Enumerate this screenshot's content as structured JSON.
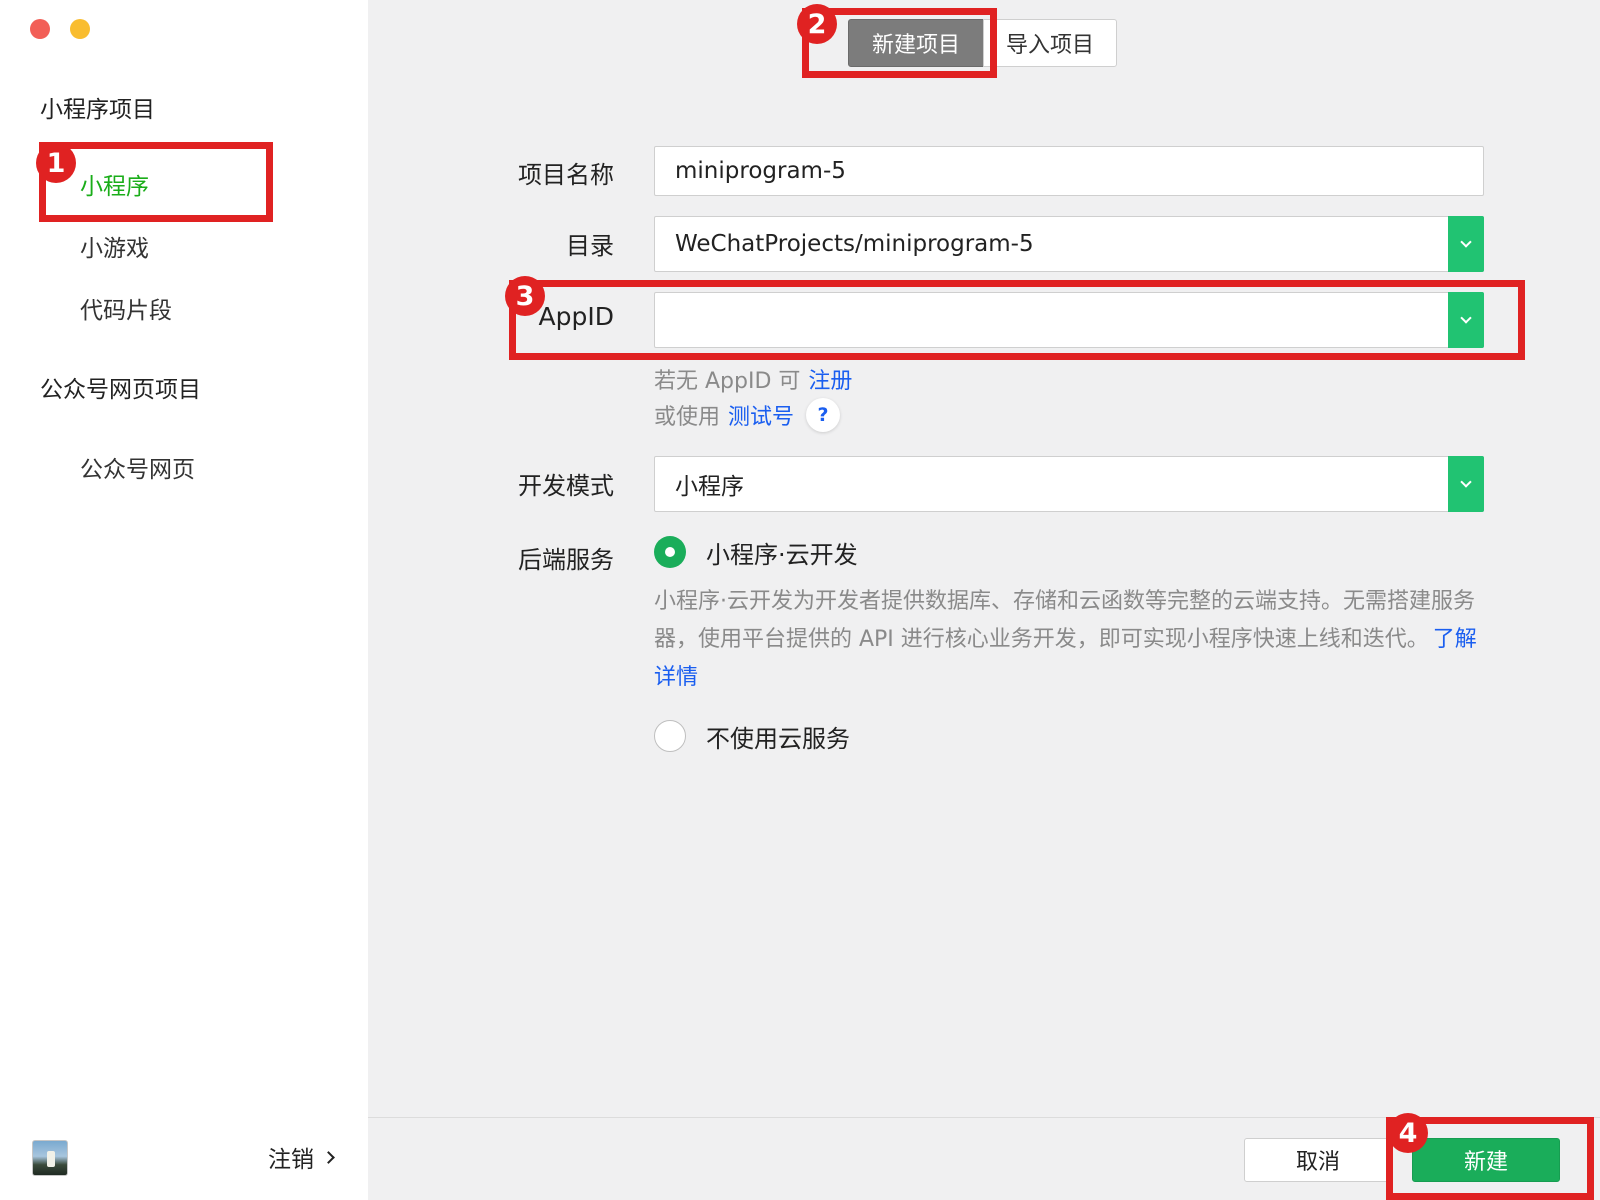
{
  "sidebar": {
    "groups": [
      {
        "title": "小程序项目",
        "items": [
          "小程序",
          "小游戏",
          "代码片段"
        ]
      },
      {
        "title": "公众号网页项目",
        "items": [
          "公众号网页"
        ]
      }
    ],
    "active_item": "小程序",
    "logout_label": "注销"
  },
  "tabs": {
    "new_project": "新建项目",
    "import_project": "导入项目",
    "active": "新建项目"
  },
  "form": {
    "project_name": {
      "label": "项目名称",
      "value": "miniprogram-5"
    },
    "directory": {
      "label": "目录",
      "value": "WeChatProjects/miniprogram-5"
    },
    "appid": {
      "label": "AppID",
      "value": "",
      "hint_prefix": "若无 AppID 可",
      "hint_register": "注册",
      "hint_test_prefix": "或使用",
      "hint_test_link": "测试号",
      "help": "?"
    },
    "dev_mode": {
      "label": "开发模式",
      "value": "小程序"
    },
    "backend": {
      "label": "后端服务",
      "option_cloud": "小程序·云开发",
      "option_cloud_selected": true,
      "description": "小程序·云开发为开发者提供数据库、存储和云函数等完整的云端支持。无需搭建服务器，使用平台提供的 API 进行核心业务开发，即可实现小程序快速上线和迭代。",
      "learn_more": "了解详情",
      "option_none": "不使用云服务",
      "option_none_selected": false
    }
  },
  "buttons": {
    "cancel": "取消",
    "create": "新建"
  },
  "annotations": {
    "badges": [
      "1",
      "2",
      "3",
      "4"
    ],
    "color": "#e02222"
  },
  "colors": {
    "accent_green": "#1aad5a",
    "dropdown_green": "#21c372",
    "link_blue": "#1a5ef0"
  }
}
